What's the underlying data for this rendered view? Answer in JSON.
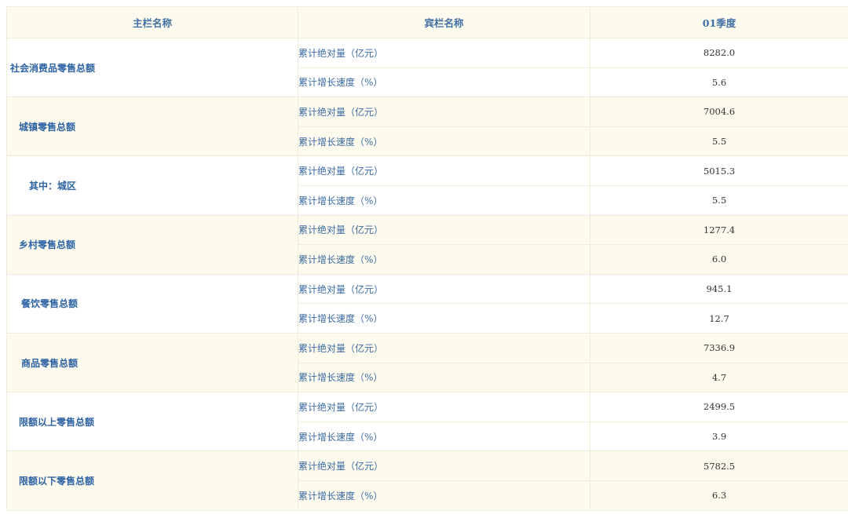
{
  "header": {
    "main": "主栏名称",
    "guest": "宾栏名称",
    "quarter": "01季度"
  },
  "rows": [
    {
      "name": "社会消费品零售总额",
      "abs_label": "累计绝对量（亿元）",
      "abs_value": "8282.0",
      "growth_label": "累计增长速度（%）",
      "growth_value": "5.6"
    },
    {
      "name": "城镇零售总额",
      "abs_label": "累计绝对量（亿元）",
      "abs_value": "7004.6",
      "growth_label": "累计增长速度（%）",
      "growth_value": "5.5"
    },
    {
      "name": "其中：城区",
      "abs_label": "累计绝对量（亿元）",
      "abs_value": "5015.3",
      "growth_label": "累计增长速度（%）",
      "growth_value": "5.5"
    },
    {
      "name": "乡村零售总额",
      "abs_label": "累计绝对量（亿元）",
      "abs_value": "1277.4",
      "growth_label": "累计增长速度（%）",
      "growth_value": "6.0"
    },
    {
      "name": "餐饮零售总额",
      "abs_label": "累计绝对量（亿元）",
      "abs_value": "945.1",
      "growth_label": "累计增长速度（%）",
      "growth_value": "12.7"
    },
    {
      "name": "商品零售总额",
      "abs_label": "累计绝对量（亿元）",
      "abs_value": "7336.9",
      "growth_label": "累计增长速度（%）",
      "growth_value": "4.7"
    },
    {
      "name": "限额以上零售总额",
      "abs_label": "累计绝对量（亿元）",
      "abs_value": "2499.5",
      "growth_label": "累计增长速度（%）",
      "growth_value": "3.9"
    },
    {
      "name": "限额以下零售总额",
      "abs_label": "累计绝对量（亿元）",
      "abs_value": "5782.5",
      "growth_label": "累计增长速度（%）",
      "growth_value": "6.3"
    }
  ]
}
